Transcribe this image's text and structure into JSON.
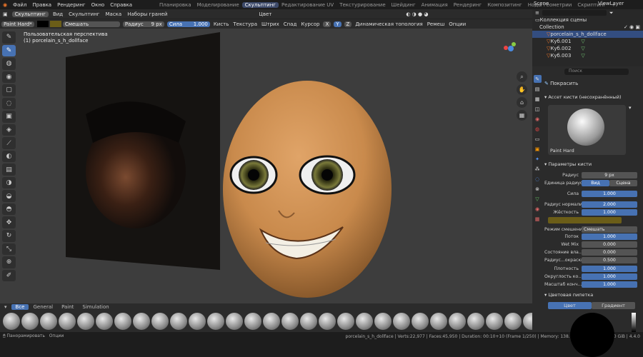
{
  "menu": {
    "items": [
      "Файл",
      "Правка",
      "Рендеринг",
      "Окно",
      "Справка"
    ],
    "workspaces": [
      "Планировка",
      "Моделирование",
      "Скульптинг",
      "Редактирование UV",
      "Текстурирование",
      "Шейдинг",
      "Анимация",
      "Рендеринг",
      "Композитинг",
      "Ноды геометрии",
      "Скриптинг"
    ],
    "active_ws": "Скульптинг",
    "scene": "Scene",
    "viewlayer": "ViewLayer"
  },
  "header": {
    "mode": "Скульптинг",
    "items": [
      "Вид",
      "Скульптинг",
      "Маска",
      "Наборы граней"
    ],
    "shading": "Цвет"
  },
  "tool": {
    "brush": "Paint Hard*",
    "blend_label": "Смешать",
    "radius_label": "Радиус",
    "radius": "9 px",
    "strength_label": "Сила",
    "strength": "1.000",
    "menus": [
      "Кисть",
      "Текстура",
      "Штрих",
      "Спад",
      "Курсор"
    ],
    "axes": [
      "X",
      "Y",
      "Z"
    ],
    "dyntopo": "Динамическая топология",
    "remesh": "Ремеш",
    "options": "Опции"
  },
  "viewport": {
    "persp": "Пользовательская перспектива",
    "object": "(1) porcelain_s_h_dollface"
  },
  "brushes": {
    "tabs": [
      "Все",
      "General",
      "Paint",
      "Simulation"
    ],
    "count": 30
  },
  "status": {
    "left1": "Панорамировать",
    "left2": "Опции",
    "right": "porcelain_s_h_dollface | Verts:22,977 | Faces:45,950 | Duration: 00:10+10 (Frame 1/250) | Memory: 138.1 MiB | VRAM: 2.4/8.0 GiB | 4.4.0"
  },
  "outliner": {
    "search": "",
    "root": "Коллекция сцены",
    "collection": "Collection",
    "objects": [
      "porcelain_s_h_dollface",
      "Куб.001",
      "Куб.002",
      "Куб.003"
    ]
  },
  "props": {
    "search": "Поиск",
    "tool_name": "Покрасить",
    "asset_section": "Ассет кисти (несохранённый)",
    "brush_name": "Paint Hard",
    "params_section": "Параметры кисти",
    "rows": [
      {
        "label": "Радиус",
        "value": "9 px",
        "blue": false
      },
      {
        "label": "Сила",
        "value": "1.000",
        "blue": true
      },
      {
        "label": "Радиус нормали",
        "value": "2.000",
        "blue": true
      },
      {
        "label": "Жёсткость",
        "value": "1.000",
        "blue": true
      },
      {
        "label": "Режим смешения",
        "value": "Смешать",
        "blue": false
      },
      {
        "label": "Поток",
        "value": "1.000",
        "blue": true
      },
      {
        "label": "Wet Mix",
        "value": "0.000",
        "blue": false
      },
      {
        "label": "Состояние вла...",
        "value": "0.000",
        "blue": false
      },
      {
        "label": "Радиус...окраски",
        "value": "0.500",
        "blue": false
      },
      {
        "label": "Плотность",
        "value": "1.000",
        "blue": true
      },
      {
        "label": "Округлость ко...",
        "value": "1.000",
        "blue": true
      },
      {
        "label": "Масштаб конч...",
        "value": "1.000",
        "blue": true
      }
    ],
    "radius_unit_label": "Единица радиуса",
    "unit_view": "Вид",
    "unit_scene": "Сцена",
    "color_section": "Цветовая пипетка",
    "color_tab": "Цвет",
    "gradient_tab": "Градиент"
  }
}
